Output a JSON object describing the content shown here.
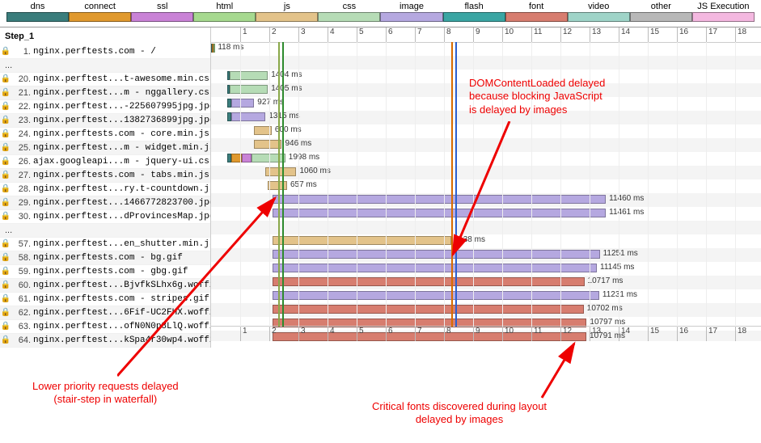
{
  "legend": [
    {
      "label": "dns",
      "color": "#3a7d7c"
    },
    {
      "label": "connect",
      "color": "#e0992e"
    },
    {
      "label": "ssl",
      "color": "#c982d6"
    },
    {
      "label": "html",
      "color": "#a6d98f"
    },
    {
      "label": "js",
      "color": "#e3c38a"
    },
    {
      "label": "css",
      "color": "#b6dcb6"
    },
    {
      "label": "image",
      "color": "#b5a8e0"
    },
    {
      "label": "flash",
      "color": "#3aa5a3"
    },
    {
      "label": "font",
      "color": "#d77d6f"
    },
    {
      "label": "video",
      "color": "#9fd4c8"
    },
    {
      "label": "other",
      "color": "#b8b8b8"
    },
    {
      "label": "JS Execution",
      "color": "#f4b8e0"
    }
  ],
  "step_label": "Step_1",
  "ticks": [
    1,
    2,
    3,
    4,
    5,
    6,
    7,
    8,
    9,
    10,
    11,
    12,
    13,
    14,
    15,
    16,
    17,
    18
  ],
  "markers": [
    {
      "x": 2.3,
      "color": "#8aa84a"
    },
    {
      "x": 2.45,
      "color": "#2d8a2d"
    },
    {
      "x": 8.25,
      "color": "#d86b00"
    },
    {
      "x": 8.4,
      "color": "#2a5fd0"
    }
  ],
  "pxPerSec": 36.0,
  "rows": [
    {
      "n": 1,
      "name": "nginx.perftests.com - /",
      "t": "118 ms",
      "segs": [
        {
          "s": 0,
          "e": 0.03,
          "c": "#3a7d7c"
        },
        {
          "s": 0.03,
          "e": 0.08,
          "c": "#e0992e"
        },
        {
          "s": 0.08,
          "e": 0.12,
          "c": "#a6d98f"
        }
      ]
    },
    {
      "dots": true
    },
    {
      "n": 20,
      "name": "nginx.perftest...t-awesome.min.css",
      "t": "1404 ms",
      "segs": [
        {
          "s": 0.55,
          "e": 0.65,
          "c": "#3a7d7c"
        },
        {
          "s": 0.65,
          "e": 1.95,
          "c": "#b6dcb6"
        }
      ]
    },
    {
      "n": 21,
      "name": "nginx.perftest...m - nggallery.css",
      "t": "1405 ms",
      "segs": [
        {
          "s": 0.55,
          "e": 0.65,
          "c": "#3a7d7c"
        },
        {
          "s": 0.65,
          "e": 1.95,
          "c": "#b6dcb6"
        }
      ]
    },
    {
      "n": 22,
      "name": "nginx.perftest...-225607995jpg.jpg",
      "t": "927 ms",
      "segs": [
        {
          "s": 0.55,
          "e": 0.7,
          "c": "#3a7d7c"
        },
        {
          "s": 0.7,
          "e": 1.48,
          "c": "#b5a8e0"
        }
      ]
    },
    {
      "n": 23,
      "name": "nginx.perftest...1382736899jpg.jpg",
      "t": "1315 ms",
      "segs": [
        {
          "s": 0.55,
          "e": 0.7,
          "c": "#3a7d7c"
        },
        {
          "s": 0.7,
          "e": 1.87,
          "c": "#b5a8e0"
        }
      ]
    },
    {
      "n": 24,
      "name": "nginx.perftests.com - core.min.js",
      "t": "600 ms",
      "segs": [
        {
          "s": 1.48,
          "e": 2.08,
          "c": "#e3c38a"
        }
      ]
    },
    {
      "n": 25,
      "name": "nginx.perftest...m - widget.min.js",
      "t": "946 ms",
      "segs": [
        {
          "s": 1.48,
          "e": 2.43,
          "c": "#e3c38a"
        }
      ]
    },
    {
      "n": 26,
      "name": "ajax.googleapi...m - jquery-ui.css",
      "t": "1998 ms",
      "segs": [
        {
          "s": 0.55,
          "e": 0.7,
          "c": "#3a7d7c"
        },
        {
          "s": 0.7,
          "e": 1.05,
          "c": "#e0992e"
        },
        {
          "s": 1.05,
          "e": 1.4,
          "c": "#c982d6"
        },
        {
          "s": 1.4,
          "e": 2.55,
          "c": "#b6dcb6"
        }
      ]
    },
    {
      "n": 27,
      "name": "nginx.perftests.com - tabs.min.js",
      "t": "1060 ms",
      "segs": [
        {
          "s": 1.87,
          "e": 2.93,
          "c": "#e3c38a"
        }
      ]
    },
    {
      "n": 28,
      "name": "nginx.perftest...ry.t-countdown.js",
      "t": "657 ms",
      "segs": [
        {
          "s": 1.95,
          "e": 2.61,
          "c": "#e3c38a"
        }
      ]
    },
    {
      "n": 29,
      "name": "nginx.perftest...1466772823700.jpg",
      "t": "11460 ms",
      "segs": [
        {
          "s": 2.1,
          "e": 13.56,
          "c": "#b5a8e0"
        }
      ]
    },
    {
      "n": 30,
      "name": "nginx.perftest...dProvincesMap.jpg",
      "t": "11461 ms",
      "segs": [
        {
          "s": 2.1,
          "e": 13.56,
          "c": "#b5a8e0"
        }
      ]
    },
    {
      "dots": true
    },
    {
      "n": 57,
      "name": "nginx.perftest...en_shutter.min.js",
      "t": "6138 ms",
      "segs": [
        {
          "s": 2.1,
          "e": 8.24,
          "c": "#e3c38a"
        }
      ]
    },
    {
      "n": 58,
      "name": "nginx.perftests.com - bg.gif",
      "t": "11251 ms",
      "segs": [
        {
          "s": 2.1,
          "e": 13.35,
          "c": "#b5a8e0"
        }
      ]
    },
    {
      "n": 59,
      "name": "nginx.perftests.com - gbg.gif",
      "t": "11145 ms",
      "segs": [
        {
          "s": 2.1,
          "e": 13.25,
          "c": "#b5a8e0"
        }
      ]
    },
    {
      "n": 60,
      "name": "nginx.perftest...BjvfkSLhx6g.woff2",
      "t": "10717 ms",
      "segs": [
        {
          "s": 2.1,
          "e": 12.82,
          "c": "#d77d6f"
        }
      ]
    },
    {
      "n": 61,
      "name": "nginx.perftests.com - stripes.gif",
      "t": "11231 ms",
      "segs": [
        {
          "s": 2.1,
          "e": 13.33,
          "c": "#b5a8e0"
        }
      ]
    },
    {
      "n": 62,
      "name": "nginx.perftest...6Fif-UC2FHX.woff2",
      "t": "10702 ms",
      "segs": [
        {
          "s": 2.1,
          "e": 12.8,
          "c": "#d77d6f"
        }
      ]
    },
    {
      "n": 63,
      "name": "nginx.perftest...ofN0N0p8LlQ.woff2",
      "t": "10797 ms",
      "segs": [
        {
          "s": 2.1,
          "e": 12.9,
          "c": "#d77d6f"
        }
      ]
    },
    {
      "n": 64,
      "name": "nginx.perftest...kSpa4r30wp4.woff2",
      "t": "10791 ms",
      "segs": [
        {
          "s": 2.1,
          "e": 12.89,
          "c": "#d77d6f"
        }
      ]
    }
  ],
  "annotations": {
    "a1": "DOMContentLoaded delayed\nbecause blocking JavaScript\nis delayed by images",
    "a2": "Lower priority requests delayed\n(stair-step in waterfall)",
    "a3": "Critical fonts discovered during layout\ndelayed by images"
  }
}
